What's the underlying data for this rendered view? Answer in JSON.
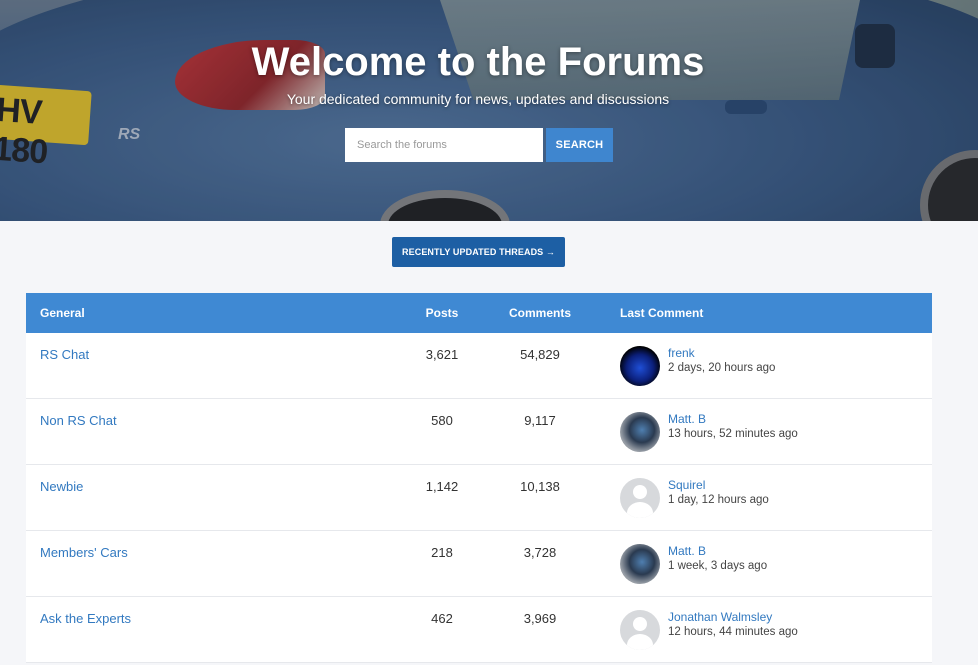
{
  "hero": {
    "title": "Welcome to the Forums",
    "subtitle": "Your dedicated community for news, updates and discussions",
    "plate_text": "HV 180",
    "badge_text": "RS"
  },
  "search": {
    "placeholder": "Search the forums",
    "value": "",
    "button_label": "SEARCH"
  },
  "recent_button": {
    "label": "RECENTLY UPDATED THREADS →"
  },
  "table": {
    "headers": {
      "name": "General",
      "posts": "Posts",
      "comments": "Comments",
      "last": "Last Comment"
    },
    "rows": [
      {
        "name": "RS Chat",
        "posts": "3,621",
        "comments": "54,829",
        "user": "frenk",
        "time": "2 days, 20 hours ago",
        "avatar": "blue"
      },
      {
        "name": "Non RS Chat",
        "posts": "580",
        "comments": "9,117",
        "user": "Matt. B",
        "time": "13 hours, 52 minutes ago",
        "avatar": "photo"
      },
      {
        "name": "Newbie",
        "posts": "1,142",
        "comments": "10,138",
        "user": "Squirel",
        "time": "1 day, 12 hours ago",
        "avatar": "default"
      },
      {
        "name": "Members' Cars",
        "posts": "218",
        "comments": "3,728",
        "user": "Matt. B",
        "time": "1 week, 3 days ago",
        "avatar": "photo"
      },
      {
        "name": "Ask the Experts",
        "posts": "462",
        "comments": "3,969",
        "user": "Jonathan Walmsley",
        "time": "12 hours, 44 minutes ago",
        "avatar": "default"
      }
    ]
  },
  "colors": {
    "accent": "#3f89d3",
    "button_dark": "#1d5fa4",
    "link": "#3279c0"
  }
}
